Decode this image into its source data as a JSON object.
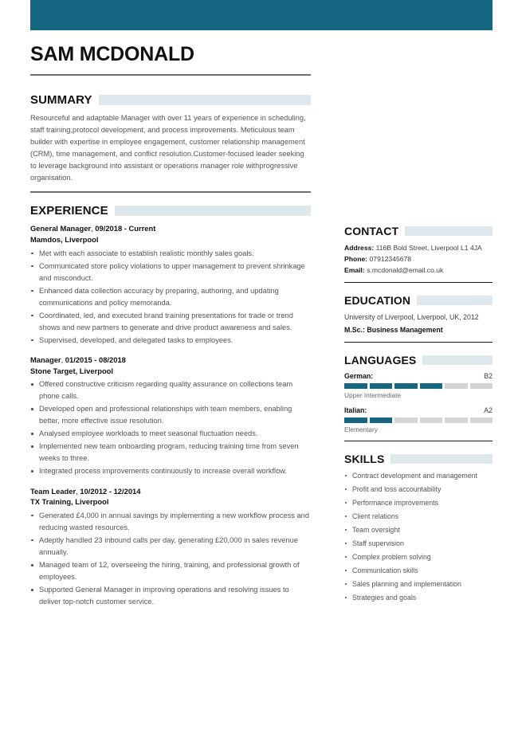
{
  "theme": {
    "banner_color": "#146681",
    "highlight_color": "#dfe8ec",
    "accent_color": "#146681",
    "body_text_color": "#545454"
  },
  "header": {
    "name": "SAM MCDONALD"
  },
  "summary": {
    "heading": "SUMMARY",
    "text": "Resourceful and adaptable Manager with over 11 years of experience in scheduling, staff training,protocol development, and process improvements. Meticulous team builder with expertise in employee engagement, customer relationship management (CRM), time management, and conflict resolution.Customer-focused leader seeking to leverage background into assistant or operations manager role withprogressive organisation."
  },
  "experience": {
    "heading": "EXPERIENCE",
    "jobs": [
      {
        "role": "General Manager",
        "dates": "09/2018 - Current",
        "company": "Mamdos, Liverpool",
        "bullets": [
          "Met with each associate to establish realistic monthly sales goals.",
          "Communicated store policy violations to upper management to prevent shrinkage and misconduct.",
          "Enhanced data collection accuracy by preparing, authoring, and updating communications and policy memoranda.",
          "Coordinated, led, and executed brand training presentations for trade or trend shows and new partners to generate and drive product awareness and sales.",
          "Supervised, developed, and delegated tasks to employees."
        ]
      },
      {
        "role": "Manager",
        "dates": "01/2015 - 08/2018",
        "company": "Stone Target, Liverpool",
        "bullets": [
          "Offered constructive criticism regarding quality assurance on collections team phone calls.",
          "Developed open and professional relationships with team members, enabling better, more effective issue resolution.",
          "Analysed employee workloads to meet seasonal fluctuation needs.",
          "Implemented new team onboarding program, reducing training time from seven weeks to three.",
          "Integrated process improvements continuously to increase overall workflow."
        ]
      },
      {
        "role": "Team Leader",
        "dates": "10/2012 - 12/2014",
        "company": "TX Training, Liverpool",
        "bullets": [
          "Generated £4,000 in annual savings by implementing a new workflow process and reducing wasted resources.",
          "Adeptly handled 23 inbound calls per day, generating £20,000 in sales revenue annually.",
          "Managed team of 12, overseeing the hiring, training, and professional growth of employees.",
          "Supported General Manager in improving operations and resolving issues to deliver top-notch customer service."
        ]
      }
    ]
  },
  "contact": {
    "heading": "CONTACT",
    "address_label": "Address:",
    "address_value": "116B Bold Street, Liverpool L1 4JA",
    "phone_label": "Phone:",
    "phone_value": "07912345678",
    "email_label": "Email:",
    "email_value": "s.mcdonald@email.co.uk"
  },
  "education": {
    "heading": "EDUCATION",
    "institution": "University of Liverpool, Liverpool, UK, 2012",
    "degree": "M.Sc.: Business Management"
  },
  "languages": {
    "heading": "LANGUAGES",
    "items": [
      {
        "name": "German:",
        "level_code": "B2",
        "description": "Upper Intermediate",
        "filled": 4,
        "total": 6
      },
      {
        "name": "Italian:",
        "level_code": "A2",
        "description": "Elementary",
        "filled": 2,
        "total": 6
      }
    ]
  },
  "skills": {
    "heading": "SKILLS",
    "items": [
      "Contract development and management",
      "Profit and loss accountability",
      "Performance improvements",
      "Client relations",
      "Team oversight",
      "Staff supervision",
      "Complex problem solving",
      "Communication skills",
      "Sales planning and implementation",
      "Strategies and goals"
    ]
  }
}
